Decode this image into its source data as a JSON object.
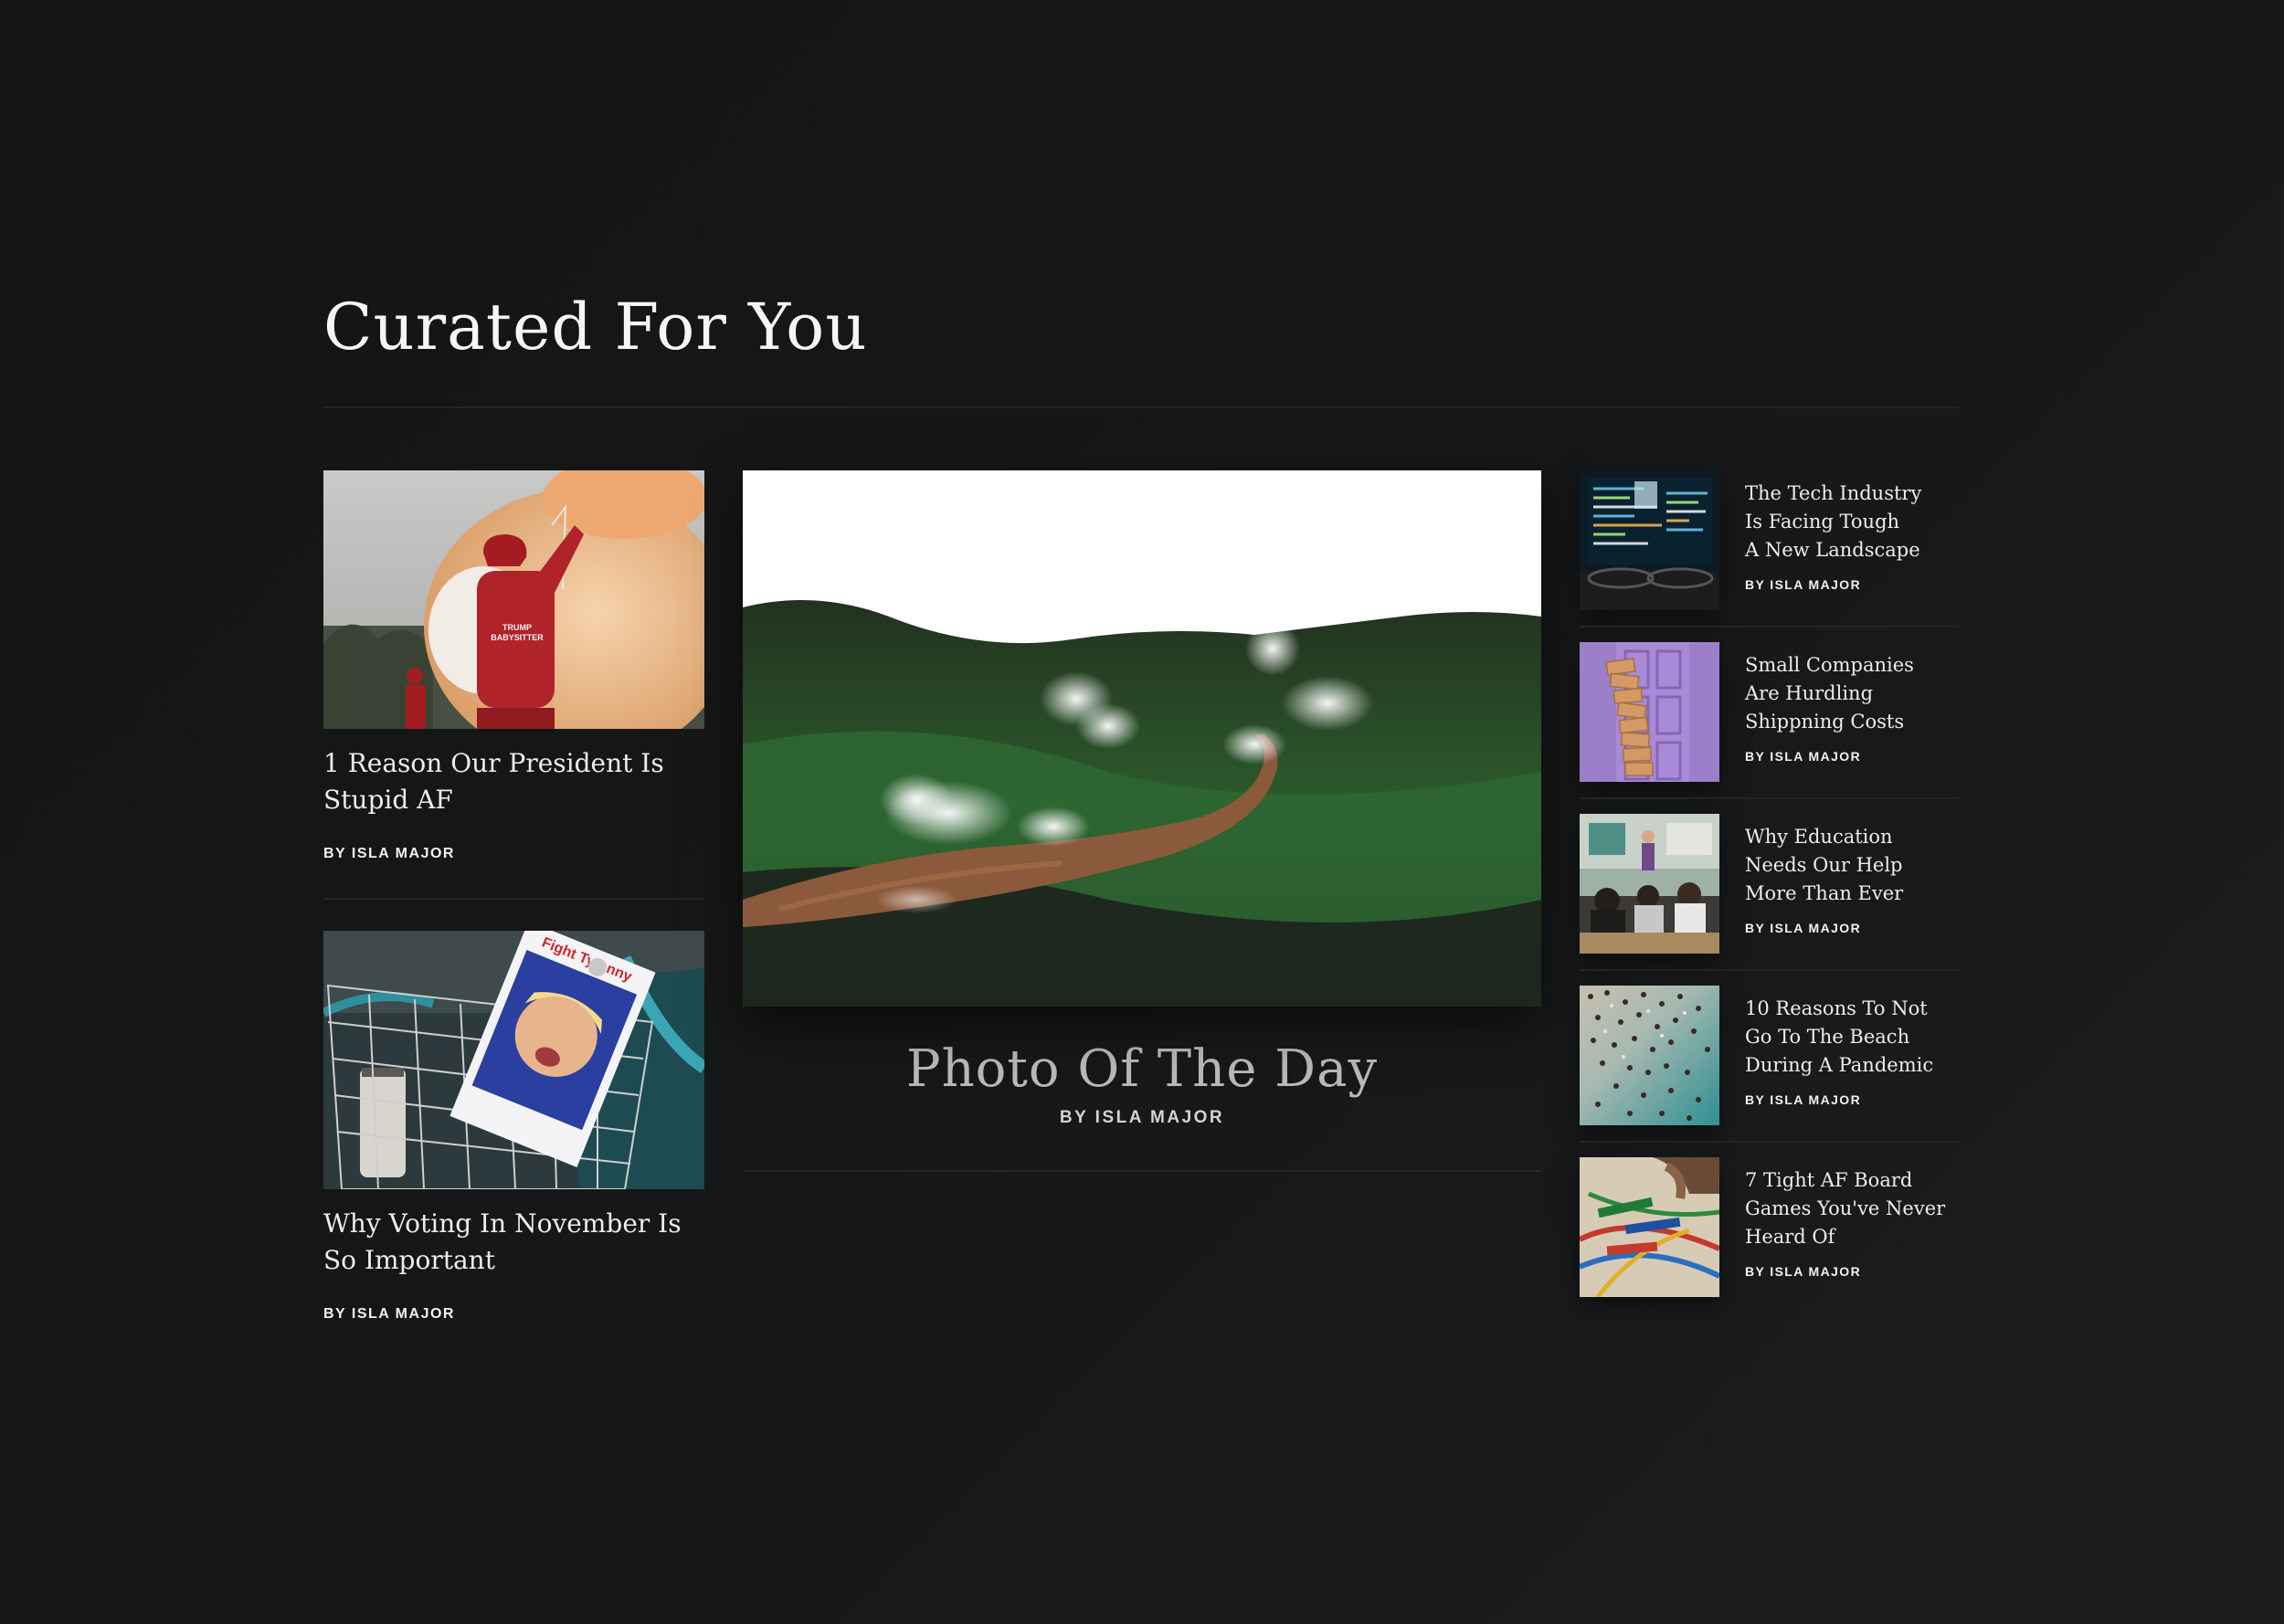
{
  "section": {
    "title": "Curated For You"
  },
  "left_articles": [
    {
      "headline": "1 Reason Our President Is Stupid AF",
      "byline": "BY ISLA MAJOR",
      "image_icon": "red-jacket-balloon-photo",
      "image_text": "TRUMP BABYSITTER"
    },
    {
      "headline": "Why Voting In November Is So Important",
      "byline": "BY ISLA MAJOR",
      "image_icon": "bike-basket-poster-photo",
      "image_text": "Fight Tyranny"
    }
  ],
  "featured": {
    "title": "Photo Of The Day",
    "byline": "BY ISLA MAJOR",
    "image_icon": "geothermal-valley-photo"
  },
  "side_articles": [
    {
      "headline": "The Tech Industry\nIs Facing Tough\nA New Landscape",
      "byline": "BY ISLA MAJOR",
      "image_icon": "code-monitor-photo"
    },
    {
      "headline": "Small Companies\nAre Hurdling\nShippning Costs",
      "byline": "BY ISLA MAJOR",
      "image_icon": "stacked-boxes-photo"
    },
    {
      "headline": "Why Education\nNeeds Our Help\nMore Than Ever",
      "byline": "BY ISLA MAJOR",
      "image_icon": "classroom-photo"
    },
    {
      "headline": "10 Reasons To Not\nGo To The Beach\nDuring A Pandemic",
      "byline": "BY ISLA MAJOR",
      "image_icon": "crowded-beach-photo"
    },
    {
      "headline": "7 Tight AF Board\nGames You've  Never\nHeard Of",
      "byline": "BY ISLA MAJOR",
      "image_icon": "board-game-photo"
    }
  ],
  "colors": {
    "background": "#161718",
    "text": "#f1f1f1",
    "muted_title": "#b9b9b9",
    "divider": "#222426"
  }
}
